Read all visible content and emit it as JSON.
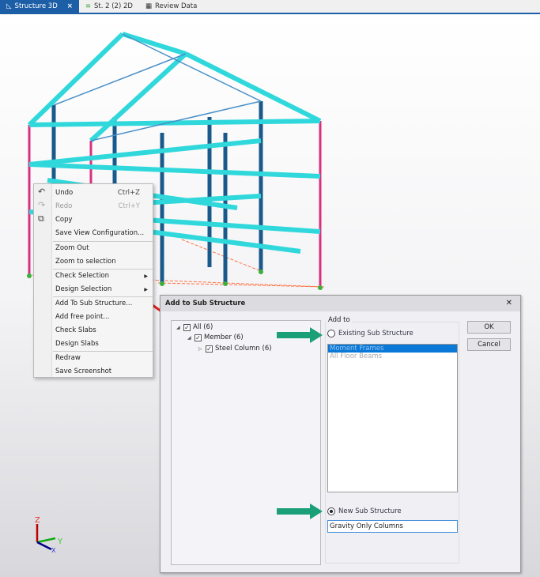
{
  "tabs": [
    {
      "label": "Structure 3D",
      "active": true,
      "close": "×"
    },
    {
      "label": "St. 2 (2) 2D"
    },
    {
      "label": "Review Data"
    }
  ],
  "axes": {
    "z": "Z",
    "y": "Y",
    "x": "X"
  },
  "context_menu": {
    "items": [
      {
        "label": "Undo",
        "shortcut": "Ctrl+Z",
        "icon": "undo-icon"
      },
      {
        "label": "Redo",
        "shortcut": "Ctrl+Y",
        "disabled": true,
        "icon": "redo-icon"
      },
      {
        "label": "Copy",
        "icon": "copy-icon"
      },
      {
        "label": "Save View Configuration..."
      },
      {
        "label": "Zoom Out"
      },
      {
        "label": "Zoom to selection"
      },
      {
        "label": "Check Selection",
        "submenu": true
      },
      {
        "label": "Design Selection",
        "submenu": true
      },
      {
        "label": "Add To Sub Structure...",
        "highlighted": true
      },
      {
        "label": "Add free point..."
      },
      {
        "label": "Check Slabs"
      },
      {
        "label": "Design Slabs"
      },
      {
        "label": "Redraw"
      },
      {
        "label": "Save Screenshot"
      }
    ]
  },
  "dialog": {
    "title": "Add to Sub Structure",
    "close": "✕",
    "tree": [
      {
        "label": "All (6)",
        "checked": true
      },
      {
        "label": "Member (6)",
        "checked": true
      },
      {
        "label": "Steel Column (6)",
        "checked": true
      }
    ],
    "group_label": "Add to",
    "existing_label": "Existing Sub Structure",
    "existing_items": [
      "Moment Frames",
      "All Floor Beams"
    ],
    "new_label": "New Sub Structure",
    "new_value": "Gravity Only Columns",
    "selected_option": "new",
    "ok": "OK",
    "cancel": "Cancel"
  },
  "colors": {
    "accent": "#1d5fa6",
    "beam": "#33e0e0",
    "column": "#1a5a8a",
    "highlight": "#7fe07f",
    "arrow_green": "#1a9f78",
    "arrow_red": "#e02020"
  }
}
